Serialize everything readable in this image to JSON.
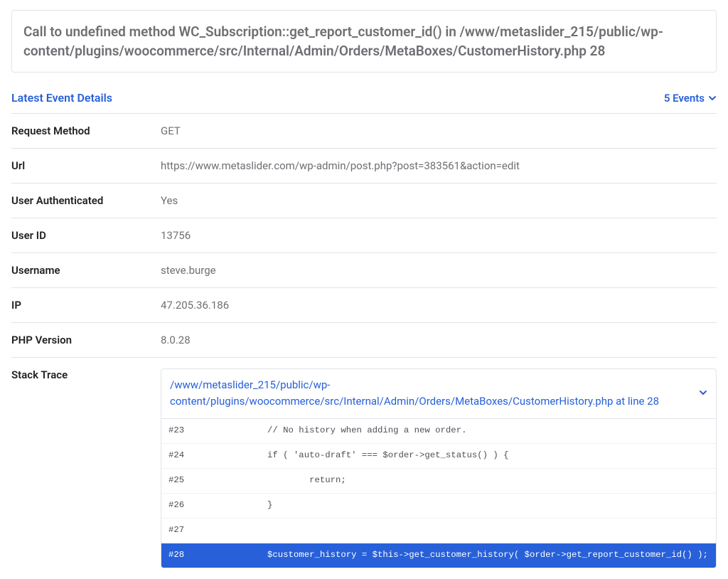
{
  "error": {
    "title": "Call to undefined method WC_Subscription::get_report_customer_id() in /www/metaslider_215/public/wp-content/plugins/woocommerce/src/Internal/Admin/Orders/MetaBoxes/CustomerHistory.php 28"
  },
  "section": {
    "title": "Latest Event Details",
    "events_label": "5 Events"
  },
  "details": [
    {
      "label": "Request Method",
      "value": "GET"
    },
    {
      "label": "Url",
      "value": "https://www.metaslider.com/wp-admin/post.php?post=383561&action=edit"
    },
    {
      "label": "User Authenticated",
      "value": "Yes"
    },
    {
      "label": "User ID",
      "value": "13756"
    },
    {
      "label": "Username",
      "value": "steve.burge"
    },
    {
      "label": "IP",
      "value": "47.205.36.186"
    },
    {
      "label": "PHP Version",
      "value": "8.0.28"
    }
  ],
  "stack_trace": {
    "label": "Stack Trace",
    "header_path": "/www/metaslider_215/public/wp-content/plugins/woocommerce/src/Internal/Admin/Orders/MetaBoxes/CustomerHistory.php at line 28",
    "lines": [
      {
        "num": "#23",
        "content": "        // No history when adding a new order.",
        "hl": false
      },
      {
        "num": "#24",
        "content": "        if ( 'auto-draft' === $order->get_status() ) {",
        "hl": false
      },
      {
        "num": "#25",
        "content": "                return;",
        "hl": false
      },
      {
        "num": "#26",
        "content": "        }",
        "hl": false
      },
      {
        "num": "#27",
        "content": "",
        "hl": false
      },
      {
        "num": "#28",
        "content": "        $customer_history = $this->get_customer_history( $order->get_report_customer_id() );",
        "hl": true
      }
    ]
  }
}
